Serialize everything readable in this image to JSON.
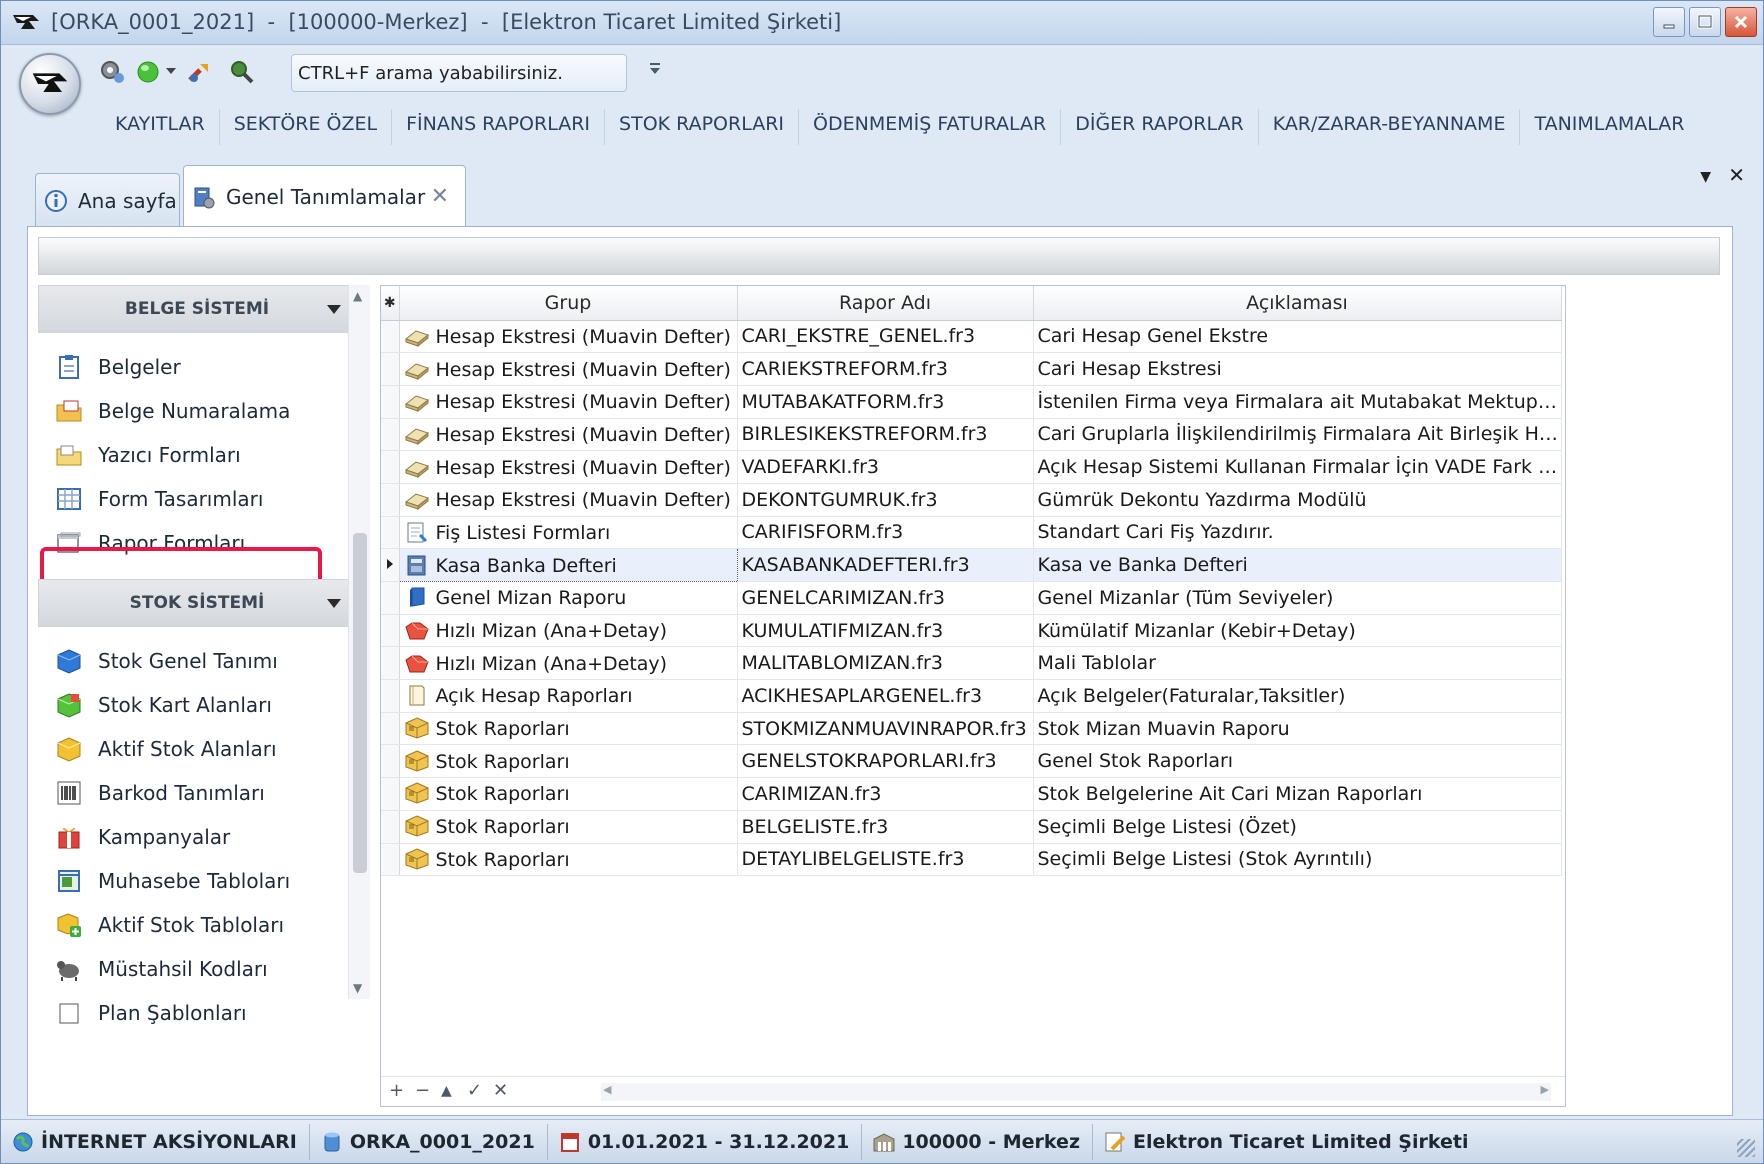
{
  "window": {
    "title": "[ORKA_0001_2021]  -  [100000-Merkez]  -  [Elektron Ticaret Limited Şirketi]"
  },
  "quick_access": {
    "search_text": "CTRL+F arama yababilirsiniz."
  },
  "ribbon": {
    "items": [
      "KAYITLAR",
      "SEKTÖRE ÖZEL",
      "FİNANS RAPORLARI",
      "STOK RAPORLARI",
      "ÖDENMEMİŞ FATURALAR",
      "DİĞER RAPORLAR",
      "KAR/ZARAR-BEYANNAME",
      "TANIMLAMALAR"
    ]
  },
  "tabs": [
    {
      "label": "Ana sayfa",
      "active": false
    },
    {
      "label": "Genel Tanımlamalar",
      "active": true,
      "close": "✕"
    }
  ],
  "doc_controls": {
    "dropdown": "▼",
    "close": "✕"
  },
  "sidebar": {
    "group1": {
      "title": "BELGE SİSTEMİ",
      "items": [
        "Belgeler",
        "Belge Numaralama",
        "Yazıcı Formları",
        "Form Tasarımları",
        "Rapor Formları"
      ]
    },
    "group2": {
      "title": "STOK SİSTEMİ",
      "items": [
        "Stok Genel Tanımı",
        "Stok Kart Alanları",
        "Aktif Stok Alanları",
        "Barkod Tanımları",
        "Kampanyalar",
        "Muhasebe Tabloları",
        "Aktif Stok Tabloları",
        "Müstahsil Kodları",
        "Plan Şablonları"
      ]
    },
    "selected_item": "Rapor Formları"
  },
  "grid": {
    "new_row_marker": "✱",
    "columns": [
      "Grup",
      "Rapor Adı",
      "Açıklaması"
    ],
    "rows": [
      {
        "grup": "Hesap Ekstresi (Muavin Defter)",
        "rapor": "CARI_EKSTRE_GENEL.fr3",
        "aciklama": "Cari Hesap Genel Ekstre",
        "icon": "ledger-icon"
      },
      {
        "grup": "Hesap Ekstresi (Muavin Defter)",
        "rapor": "CARIEKSTREFORM.fr3",
        "aciklama": "Cari Hesap Ekstresi",
        "icon": "ledger-icon"
      },
      {
        "grup": "Hesap Ekstresi (Muavin Defter)",
        "rapor": "MUTABAKATFORM.fr3",
        "aciklama": "İstenilen Firma veya Firmalara ait Mutabakat Mektupları ...",
        "icon": "ledger-icon"
      },
      {
        "grup": "Hesap Ekstresi (Muavin Defter)",
        "rapor": "BIRLESIKEKSTREFORM.fr3",
        "aciklama": "Cari Gruplarla İlişkilendirilmiş Firmalara Ait Birleşik Hesa...",
        "icon": "ledger-icon"
      },
      {
        "grup": "Hesap Ekstresi (Muavin Defter)",
        "rapor": "VADEFARKI.fr3",
        "aciklama": "Açık Hesap Sistemi Kullanan Firmalar İçin VADE Fark An...",
        "icon": "ledger-icon"
      },
      {
        "grup": "Hesap Ekstresi (Muavin Defter)",
        "rapor": "DEKONTGUMRUK.fr3",
        "aciklama": "Gümrük Dekontu Yazdırma Modülü",
        "icon": "ledger-icon"
      },
      {
        "grup": "Fiş Listesi Formları",
        "rapor": "CARIFISFORM.fr3",
        "aciklama": "Standart Cari Fiş  Yazdırır.",
        "icon": "receipt-icon"
      },
      {
        "grup": "Kasa Banka Defteri",
        "rapor": "KASABANKADEFTERI.fr3",
        "aciklama": "Kasa ve Banka Defteri",
        "icon": "cashbook-icon",
        "selected": true
      },
      {
        "grup": "Genel Mizan Raporu",
        "rapor": "GENELCARIMIZAN.fr3",
        "aciklama": "Genel Mizanlar (Tüm Seviyeler)",
        "icon": "book-icon"
      },
      {
        "grup": "Hızlı Mizan (Ana+Detay)",
        "rapor": "KUMULATIFMIZAN.fr3",
        "aciklama": "Kümülatif Mizanlar (Kebir+Detay)",
        "icon": "red-folder-icon"
      },
      {
        "grup": "Hızlı Mizan (Ana+Detay)",
        "rapor": "MALITABLOMIZAN.fr3",
        "aciklama": "Mali Tablolar",
        "icon": "red-folder-icon"
      },
      {
        "grup": "Açık Hesap Raporları",
        "rapor": "ACIKHESAPLARGENEL.fr3",
        "aciklama": "Açık Belgeler(Faturalar,Taksitler)",
        "icon": "document-icon"
      },
      {
        "grup": "Stok Raporları",
        "rapor": "STOKMIZANMUAVINRAPOR.fr3",
        "aciklama": "Stok Mizan Muavin Raporu",
        "icon": "box-icon"
      },
      {
        "grup": "Stok Raporları",
        "rapor": "GENELSTOKRAPORLARI.fr3",
        "aciklama": "Genel Stok Raporları",
        "icon": "box-icon"
      },
      {
        "grup": "Stok Raporları",
        "rapor": "CARIMIZAN.fr3",
        "aciklama": "Stok Belgelerine Ait Cari Mizan Raporları",
        "icon": "box-icon"
      },
      {
        "grup": "Stok Raporları",
        "rapor": "BELGELISTE.fr3",
        "aciklama": "Seçimli Belge Listesi (Özet)",
        "icon": "box-icon"
      },
      {
        "grup": "Stok Raporları",
        "rapor": "DETAYLIBELGELISTE.fr3",
        "aciklama": "Seçimli Belge Listesi (Stok Ayrıntılı)",
        "icon": "box-icon"
      }
    ],
    "navigator": [
      "+",
      "−",
      "▲",
      "✓",
      "✕"
    ]
  },
  "statusbar": {
    "items": [
      {
        "label": "İNTERNET AKSİYONLARI",
        "icon": "globe-icon"
      },
      {
        "label": "ORKA_0001_2021",
        "icon": "database-icon"
      },
      {
        "label": "01.01.2021 - 31.12.2021",
        "icon": "calendar-icon"
      },
      {
        "label": "100000 - Merkez",
        "icon": "building-icon"
      },
      {
        "label": "Elektron Ticaret Limited Şirketi",
        "icon": "pencil-doc-icon"
      }
    ]
  },
  "colors": {
    "highlight_border": "#e8194a",
    "selected_row": "#e9f0fb",
    "chrome_blue": "#dfe9f5"
  }
}
